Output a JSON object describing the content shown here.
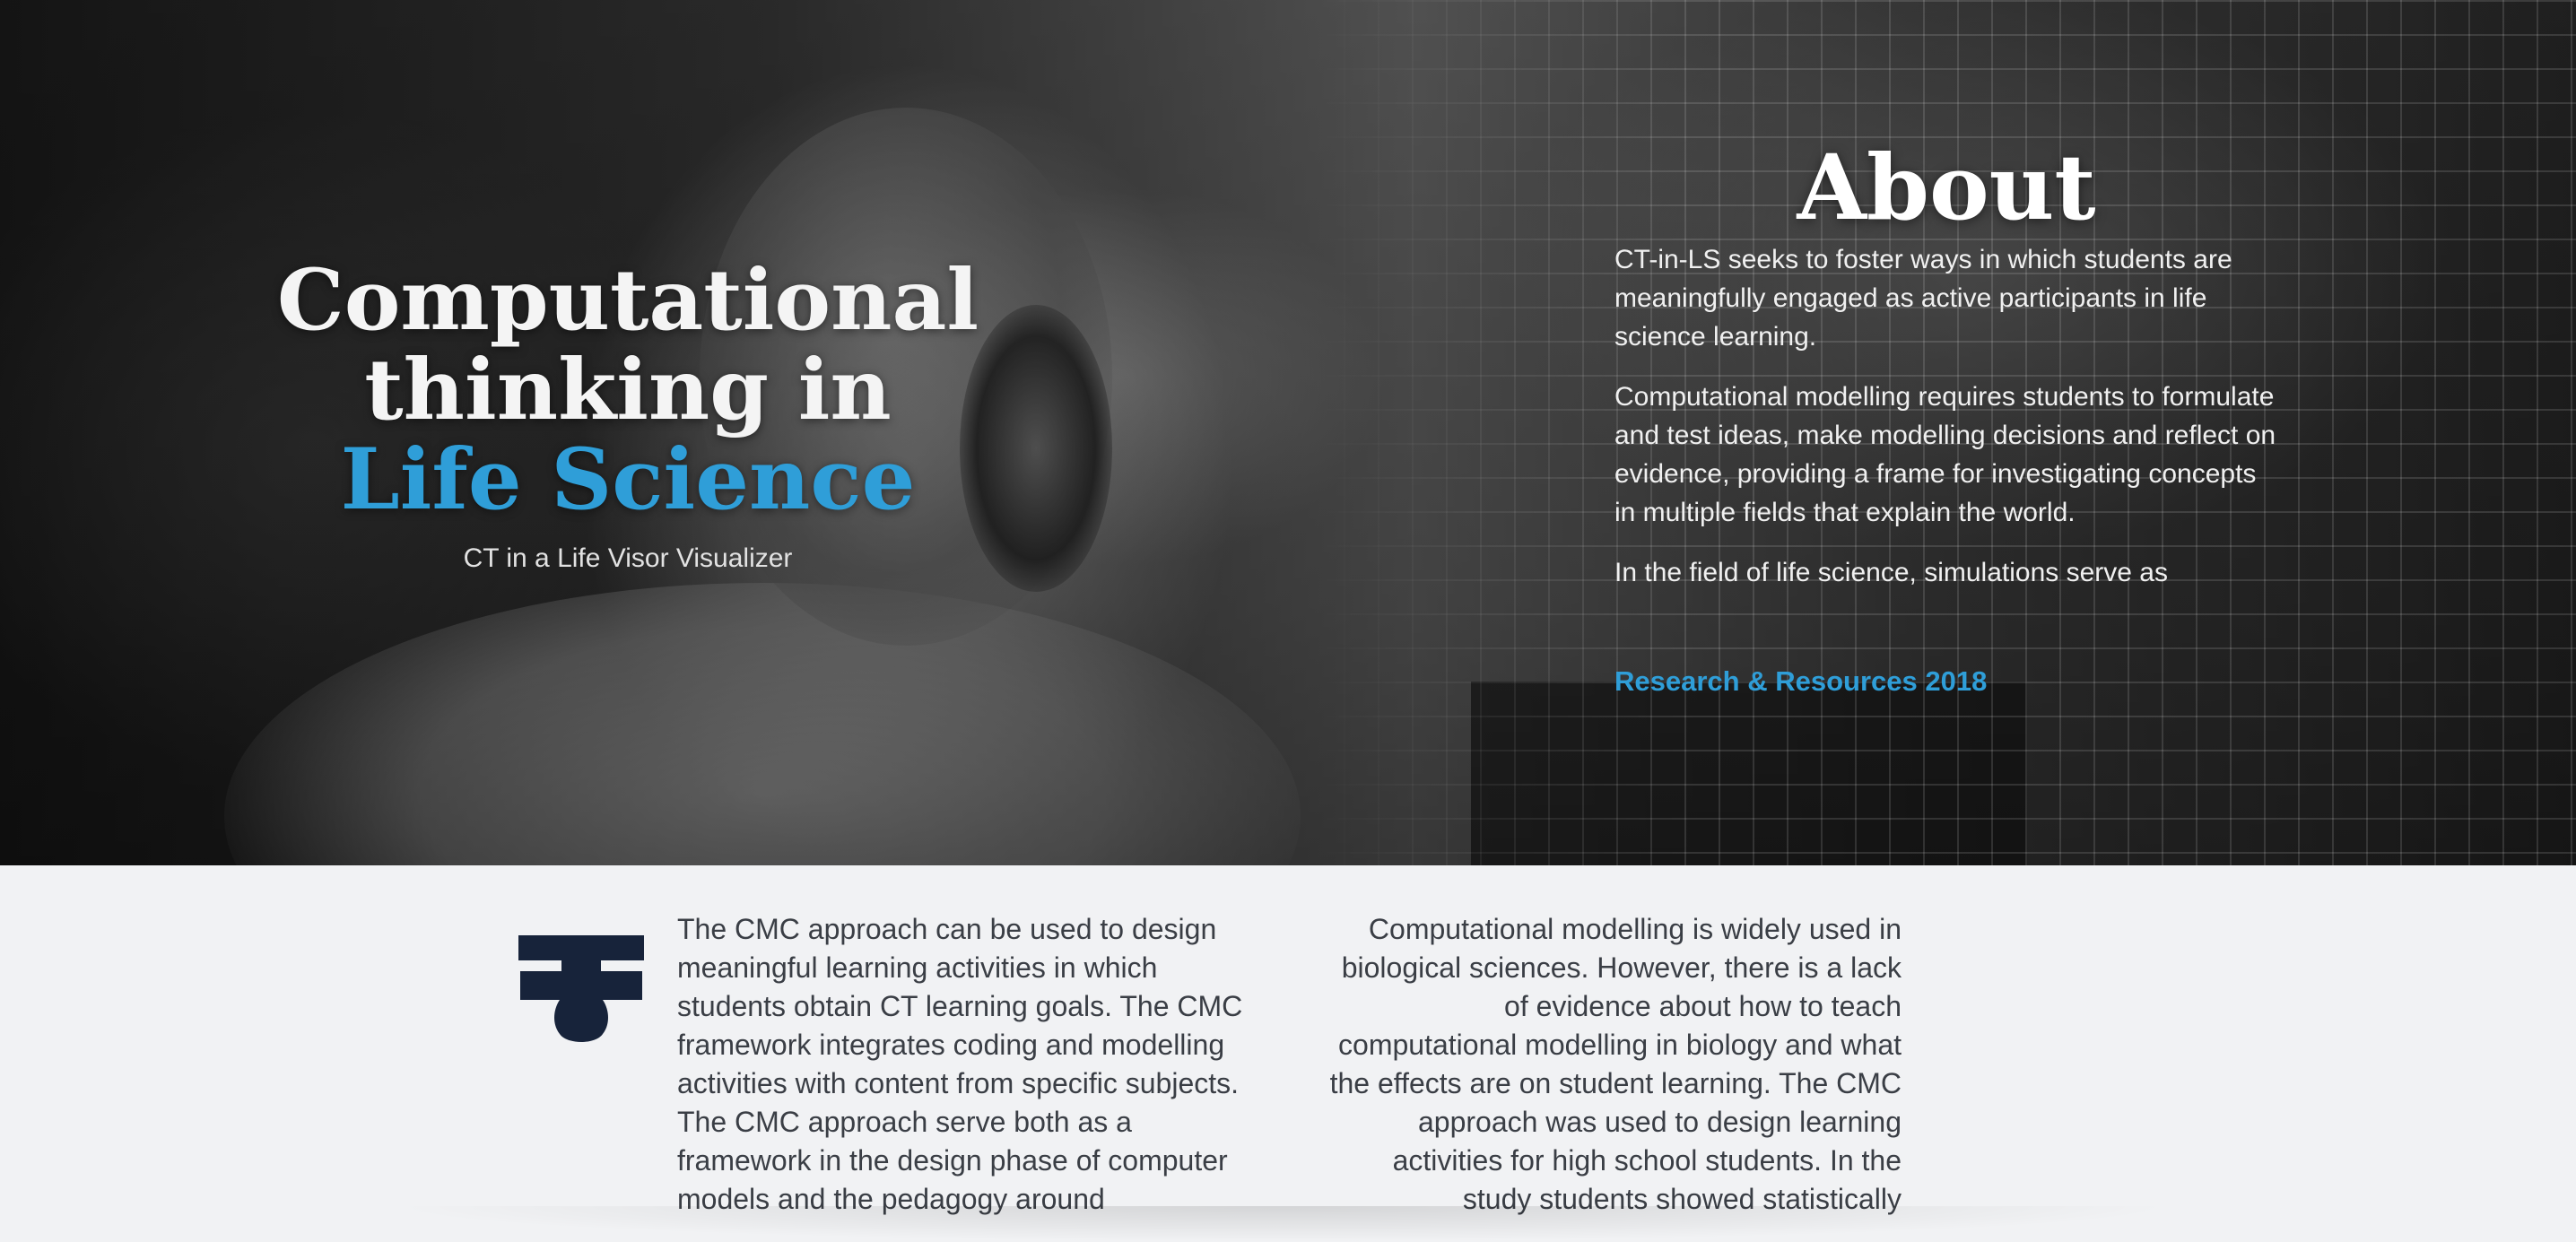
{
  "hero": {
    "title_line1": "Computational",
    "title_line2": "thinking in",
    "title_line3": "Life Science",
    "subtitle": "CT in a Life Visor Visualizer",
    "accent_color": "#2f9ed8"
  },
  "about": {
    "heading": "About",
    "paragraph1": "CT-in-LS seeks to foster ways in which students are meaningfully engaged as active participants in life science learning.",
    "paragraph2": "Computational modelling requires students to formulate and test ideas, make modelling decisions and reflect on evidence, providing a frame for investigating concepts in multiple fields that explain the world.",
    "paragraph3": "In the field of life science, simulations serve as",
    "link": "Research & Resources 2018"
  },
  "content": {
    "logo_icon": "puzzle-piece-icon",
    "left_text": "The CMC approach can be used to design meaningful learning activities in which students obtain CT learning goals. The CMC framework integrates coding and modelling activities with content from specific subjects. The CMC approach serve both as a framework in the design phase of computer models and the pedagogy around",
    "right_text": "Computational modelling is widely used in biological sciences. However, there is a lack of evidence about how to teach computational modelling in biology and what the effects are on student learning. The CMC approach was used to design learning activities for high school students. In the study students showed statistically"
  }
}
